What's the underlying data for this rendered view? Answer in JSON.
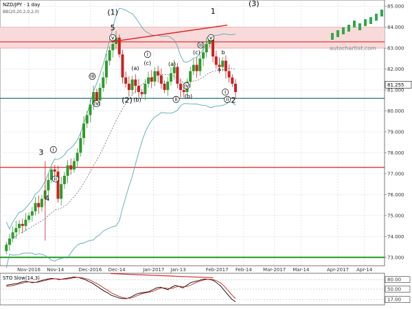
{
  "header": {
    "symbol_label": "NZD/JPY · 1 day",
    "indicator_label": "BB(20,20,2,0,2,0)"
  },
  "brand": {
    "logo_text": "autochartist.com",
    "logo_colors": {
      "green": "#2fa84f",
      "text": "#7a8a99"
    }
  },
  "colors": {
    "bull": "#2e9b2e",
    "bear": "#cc1f1f",
    "resistance_band": "#f8dada",
    "resistance_line": "#e02020",
    "support_line": "#1f6f6f",
    "green_line": "#1e9a1e",
    "bb": "#5aa7b3",
    "stoch_k": "#000000",
    "stoch_d": "#cc1f1f"
  },
  "chart_data": [
    {
      "type": "candlestick",
      "title": "NZD/JPY · 1 day",
      "x_tick_labels": [
        "Nov-2016",
        "Nov-14",
        "Dec-2016",
        "Dec-14",
        "Jan-2017",
        "Jan-13",
        "Feb-2017",
        "Feb-14",
        "Mar-2017",
        "Mar-14",
        "Apr-2017",
        "Apr-14"
      ],
      "y_tick_labels": [
        "85.000",
        "84.000",
        "83.000",
        "82.000",
        "81.000",
        "80.000",
        "79.000",
        "78.000",
        "77.000",
        "76.000",
        "75.000",
        "74.000",
        "73.000"
      ],
      "ylim": [
        72.6,
        85.3
      ],
      "current_price_label": "81.255",
      "levels": {
        "resistance_band": [
          83.0,
          84.0
        ],
        "resistance_lines": [
          83.3,
          77.3
        ],
        "support_line": 80.6,
        "green_line": 73.0
      },
      "trendline": {
        "from": [
          "Dec-11",
          83.3
        ],
        "to": [
          "Feb-06",
          84.1
        ]
      },
      "wave_labels": [
        {
          "text": "(1)",
          "at": [
            "Dec-12",
            84.6
          ]
        },
        {
          "text": "5",
          "at": [
            "Dec-12",
            83.85
          ]
        },
        {
          "text": "1",
          "at": [
            "Jan-30",
            84.65
          ]
        },
        {
          "text": "(3)",
          "at": [
            "Feb-19",
            85.0
          ]
        },
        {
          "text": "3",
          "at": [
            "Nov-07",
            77.9
          ]
        },
        {
          "text": "4",
          "at": [
            "Nov-10",
            75.7
          ]
        },
        {
          "text": "(2)",
          "at": [
            "Dec-19",
            80.4
          ]
        },
        {
          "text": "2",
          "at": [
            "Feb-09",
            80.4
          ]
        }
      ],
      "circle_labels": [
        {
          "text": "v",
          "at": [
            "Dec-12",
            83.5
          ]
        },
        {
          "text": "iii",
          "at": [
            "Dec-02",
            81.65
          ]
        },
        {
          "text": "iv",
          "at": [
            "Dec-04",
            80.35
          ]
        },
        {
          "text": "i",
          "at": [
            "Nov-13",
            78.15
          ]
        },
        {
          "text": "ii",
          "at": [
            "Nov-14",
            76.75
          ]
        },
        {
          "text": "i",
          "at": [
            "Dec-29",
            82.7
          ]
        },
        {
          "text": "ii",
          "at": [
            "Jan-12",
            80.55
          ]
        },
        {
          "text": "iii",
          "at": [
            "Jan-24",
            83.15
          ]
        },
        {
          "text": "iv",
          "at": [
            "Jan-17",
            81.2
          ]
        },
        {
          "text": "v",
          "at": [
            "Jan-29",
            83.5
          ]
        },
        {
          "text": "i",
          "at": [
            "Feb-05",
            80.9
          ]
        },
        {
          "text": "ii",
          "at": [
            "Feb-06",
            80.55
          ]
        }
      ],
      "paren_labels": [
        {
          "text": "(a)",
          "at": [
            "Dec-23",
            81.95
          ]
        },
        {
          "text": "(b)",
          "at": [
            "Dec-24",
            80.45
          ]
        },
        {
          "text": "(c)",
          "at": [
            "Dec-29",
            82.2
          ]
        },
        {
          "text": "(a)",
          "at": [
            "Jan-10",
            82.15
          ]
        },
        {
          "text": "(b)",
          "at": [
            "Jan-18",
            80.6
          ]
        },
        {
          "text": "(c)",
          "at": [
            "Jan-22",
            82.7
          ]
        },
        {
          "text": "a",
          "at": [
            "Feb-02",
            81.9
          ]
        },
        {
          "text": "b",
          "at": [
            "Feb-04",
            82.7
          ]
        }
      ]
    },
    {
      "type": "line",
      "title": "STO Slow(14,3)",
      "y_tick_labels": [
        "80.00",
        "50.00",
        "17.00"
      ],
      "ylim": [
        0,
        100
      ],
      "series": [
        {
          "name": "%K",
          "values": [
            62,
            64,
            66,
            68,
            72,
            75,
            73,
            70,
            72,
            76,
            79,
            82,
            84,
            83,
            80,
            82,
            84,
            86,
            88,
            87,
            84,
            80,
            74,
            68,
            60,
            52,
            44,
            38,
            30,
            26,
            22,
            20,
            20,
            24,
            30,
            36,
            38,
            40,
            42,
            48,
            54,
            56,
            52,
            48,
            56,
            62,
            58,
            54,
            62,
            70,
            74,
            76,
            80,
            82,
            80,
            78,
            70,
            60,
            46,
            32,
            18,
            10
          ]
        },
        {
          "name": "%D",
          "values": [
            58,
            60,
            62,
            65,
            68,
            71,
            73,
            72,
            71,
            73,
            76,
            79,
            82,
            83,
            82,
            81,
            82,
            84,
            86,
            87,
            86,
            84,
            80,
            74,
            68,
            61,
            53,
            46,
            38,
            32,
            27,
            23,
            21,
            21,
            25,
            30,
            35,
            38,
            40,
            43,
            48,
            53,
            54,
            52,
            52,
            56,
            59,
            58,
            58,
            62,
            68,
            73,
            77,
            80,
            81,
            80,
            76,
            70,
            59,
            46,
            32,
            20
          ]
        }
      ]
    }
  ]
}
